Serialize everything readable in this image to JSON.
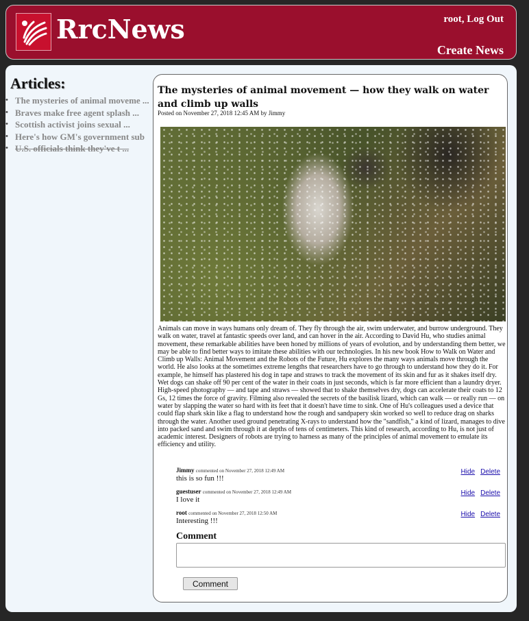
{
  "header": {
    "site_title": "RrcNews",
    "username": "root",
    "logout_label": "Log Out",
    "create_news_label": "Create News",
    "brand_color": "#9a0f2d"
  },
  "sidebar": {
    "title": "Articles:",
    "items": [
      {
        "label": "The mysteries of animal moveme ...",
        "struck": false
      },
      {
        "label": "Braves make free agent splash ...",
        "struck": false
      },
      {
        "label": "Scottish activist joins sexual ...",
        "struck": false
      },
      {
        "label": "Here's how GM's government sub",
        "struck": false
      },
      {
        "label": "U.S. officials think they've t ...",
        "struck": true
      }
    ]
  },
  "article": {
    "title": "The mysteries of animal movement — how they walk on water and climb up walls",
    "posted": "Posted on November 27, 2018 12:45 AM by Jimmy",
    "image_icon": "dog-shaking-water-photo",
    "body": "Animals can move in ways humans only dream of. They fly through the air, swim underwater, and burrow underground. They walk on water, travel at fantastic speeds over land, and can hover in the air. According to David Hu, who studies animal movement, these remarkable abilities have been honed by millions of years of evolution, and by understanding them better, we may be able to find better ways to imitate these abilities with our technologies. In his new book How to Walk on Water and Climb up Walls: Animal Movement and the Robots of the Future, Hu explores the many ways animals move through the world. He also looks at the sometimes extreme lengths that researchers have to go through to understand how they do it. For example, he himself has plastered his dog in tape and straws to track the movement of its skin and fur as it shakes itself dry. Wet dogs can shake off 90 per cent of the water in their coats in just seconds, which is far more efficient than a laundry dryer. High-speed photography — and tape and straws — showed that to shake themselves dry, dogs can accelerate their coats to 12 Gs, 12 times the force of gravity. Filming also revealed the secrets of the basilisk lizard, which can walk — or really run — on water by slapping the water so hard with its feet that it doesn't have time to sink. One of Hu's colleagues used a device that could flap shark skin like a flag to understand how the rough and sandpapery skin worked so well to reduce drag on sharks through the water. Another used ground penetrating X-rays to understand how the \"sandfish,\" a kind of lizard, manages to dive into packed sand and swim through it at depths of tens of centimeters. This kind of research, according to Hu, is not just of academic interest. Designers of robots are trying to harness as many of the principles of animal movement to emulate its efficiency and utility."
  },
  "comments": [
    {
      "author": "Jimmy",
      "meta": "commented on November 27, 2018 12:49 AM",
      "text": "this is so fun !!!",
      "hide": "Hide",
      "delete": "Delete"
    },
    {
      "author": "guestuser",
      "meta": "commented on November 27, 2018 12:49 AM",
      "text": "I love it",
      "hide": "Hide",
      "delete": "Delete"
    },
    {
      "author": "root",
      "meta": "commented on November 27, 2018 12:50 AM",
      "text": "Interesting !!!",
      "hide": "Hide",
      "delete": "Delete"
    }
  ],
  "comment_form": {
    "label": "Comment",
    "value": "",
    "button_label": "Comment"
  }
}
